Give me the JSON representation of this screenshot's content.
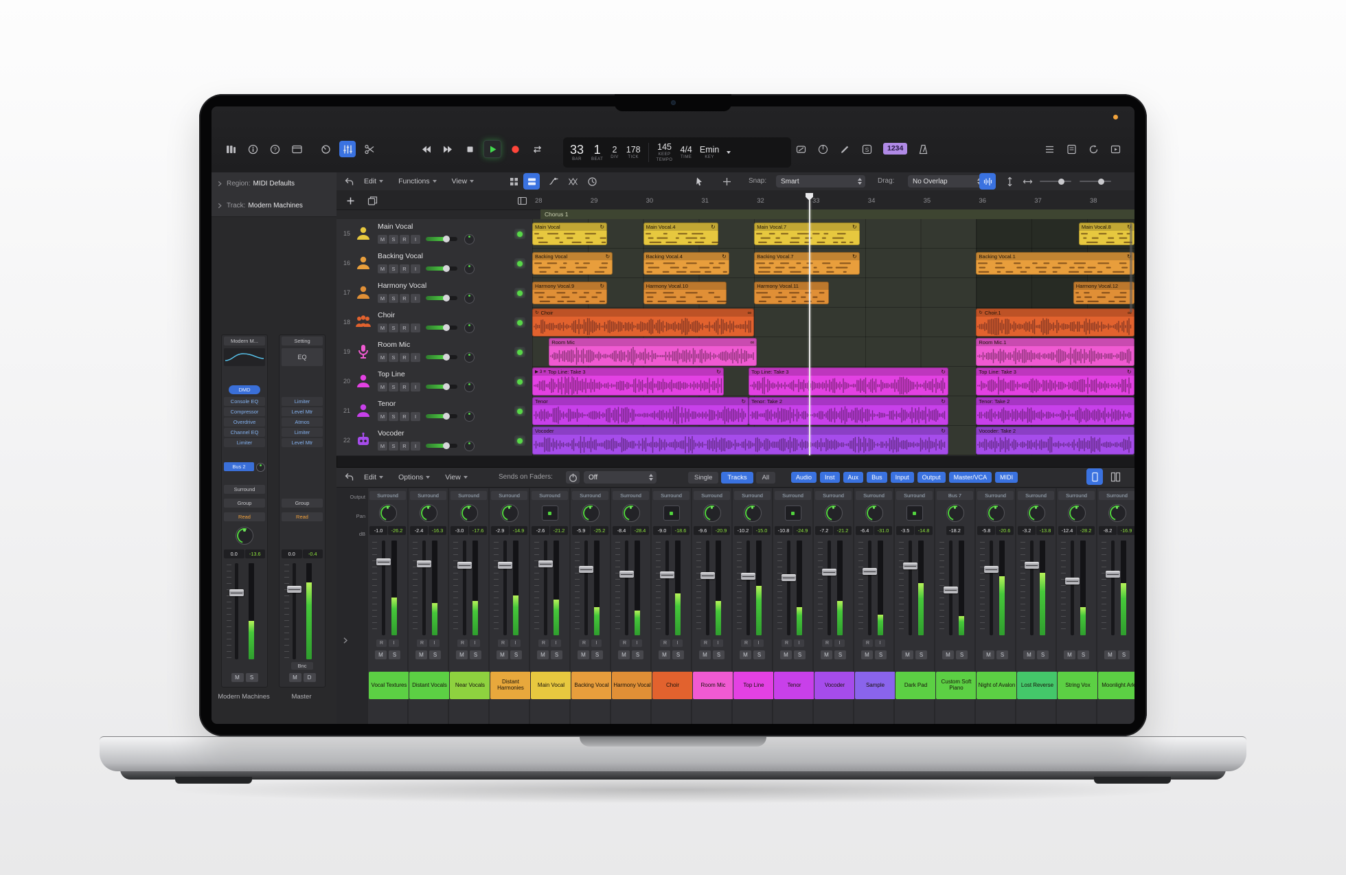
{
  "control_bar": {
    "left_icons": [
      "library-icon",
      "inspector-icon",
      "quick-help-icon",
      "toolbar-icon"
    ],
    "mode_icons": [
      "smart-controls-icon",
      "mixer-icon",
      "editors-icon"
    ],
    "transport_icons": [
      "rewind-icon",
      "forward-icon",
      "stop-icon",
      "play-icon",
      "record-icon",
      "cycle-icon"
    ],
    "lcd": {
      "bar": "33",
      "bar_label": "BAR",
      "beat": "1",
      "beat_label": "BEAT",
      "div": "2",
      "div_label": "DIV",
      "tick": "178",
      "tick_label": "TICK",
      "tempo": "145",
      "tempo_mode": "KEEP",
      "tempo_label": "TEMPO",
      "time_sig": "4/4",
      "time_label": "TIME",
      "key": "Emin",
      "key_label": "KEY"
    },
    "status_icons": [
      "punch-icon",
      "tuner-icon",
      "pencil-icon",
      "solo-icon"
    ],
    "count_in_badge": "1234",
    "metronome_icon": "metronome-icon",
    "right_icons": [
      "list-editors-icon",
      "note-pads-icon",
      "loop-browser-icon",
      "browsers-icon"
    ]
  },
  "inspector": {
    "region": {
      "label": "Region:",
      "value": "MIDI Defaults"
    },
    "track": {
      "label": "Track:",
      "value": "Modern Machines"
    },
    "strips": [
      {
        "setting": "Modern M...",
        "dmd": "DMD",
        "plugins": [
          "Console EQ",
          "Compressor",
          "Overdrive",
          "Channel EQ",
          "Limiter"
        ],
        "send": "Bus 2",
        "output": "Surround",
        "group": "Group",
        "automation": "Read",
        "volume": "0.0",
        "level": "-13.6",
        "buttons": [
          "M",
          "S"
        ],
        "name": "Modern Machines"
      },
      {
        "setting": "Setting",
        "eq_label": "EQ",
        "plugins": [
          "Limiter",
          "Level Mtr",
          "Atmos",
          "Limiter",
          "Level Mtr"
        ],
        "group": "Group",
        "automation": "Read",
        "volume": "0.0",
        "level": "-0.4",
        "bounce": "Bnc",
        "buttons": [
          "M",
          "D"
        ],
        "name": "Master"
      }
    ]
  },
  "tracks_area": {
    "menus": [
      "Edit",
      "Functions",
      "View"
    ],
    "left_icons": [
      "back-icon",
      "grid-cells-icon",
      "grid-rows-icon",
      "automation-icon",
      "crossfade-icon",
      "flex-icon"
    ],
    "tool_icons": [
      "pointer-tool-icon",
      "marquee-tool-icon"
    ],
    "right_icons": [
      "catch-icon",
      "vzoom-icon",
      "hzoom-icon"
    ],
    "ruler_icons": [
      "plus-icon",
      "dup-track-icon",
      "header-config-icon"
    ],
    "snap": {
      "label": "Snap:",
      "value": "Smart"
    },
    "drag": {
      "label": "Drag:",
      "value": "No Overlap"
    },
    "ruler_bars": [
      "28",
      "29",
      "30",
      "31",
      "32",
      "33",
      "34",
      "35",
      "36",
      "37",
      "38"
    ],
    "section_marker": "Chorus 1",
    "playhead_bar": 33,
    "tracks": [
      {
        "num": "15",
        "name": "Main Vocal",
        "icon": "vocalist-icon",
        "color": "#e7c83f",
        "buttons": [
          "M",
          "S",
          "R",
          "I"
        ]
      },
      {
        "num": "16",
        "name": "Backing Vocal",
        "icon": "vocalist-icon",
        "color": "#e89e3c",
        "buttons": [
          "M",
          "S",
          "R",
          "I"
        ]
      },
      {
        "num": "17",
        "name": "Harmony Vocal",
        "icon": "vocalist-icon",
        "color": "#e08f36",
        "buttons": [
          "M",
          "S",
          "R",
          "I"
        ]
      },
      {
        "num": "18",
        "name": "Choir",
        "icon": "choir-icon",
        "color": "#e2622e",
        "buttons": [
          "M",
          "S",
          "R",
          "I"
        ]
      },
      {
        "num": "19",
        "name": "Room Mic",
        "icon": "mic-icon",
        "color": "#f05ad2",
        "buttons": [
          "M",
          "S",
          "R",
          "I"
        ]
      },
      {
        "num": "20",
        "name": "Top Line",
        "icon": "vocalist-icon",
        "color": "#e341e3",
        "buttons": [
          "M",
          "S",
          "R",
          "I"
        ]
      },
      {
        "num": "21",
        "name": "Tenor",
        "icon": "vocalist-icon",
        "color": "#c840ea",
        "buttons": [
          "M",
          "S",
          "R",
          "I"
        ]
      },
      {
        "num": "22",
        "name": "Vocoder",
        "icon": "robot-icon",
        "color": "#a64ceb",
        "buttons": [
          "M",
          "S",
          "R",
          "I"
        ]
      }
    ],
    "regions": [
      {
        "track": 0,
        "label": "Main Vocal",
        "start": 28,
        "len": 1.35,
        "type": "notes",
        "badge": "loop"
      },
      {
        "track": 0,
        "label": "Main Vocal.4",
        "start": 30,
        "len": 1.35,
        "type": "notes",
        "badge": "loop"
      },
      {
        "track": 0,
        "label": "Main Vocal.7",
        "start": 32,
        "len": 1.9,
        "type": "notes",
        "badge": "loop"
      },
      {
        "track": 0,
        "label": "Main Vocal.8",
        "start": 37.85,
        "len": 1.0,
        "type": "notes",
        "badge": "loop"
      },
      {
        "track": 1,
        "label": "Backing Vocal",
        "start": 28,
        "len": 1.45,
        "type": "notes",
        "badge": "loop"
      },
      {
        "track": 1,
        "label": "Backing Vocal.4",
        "start": 30,
        "len": 1.55,
        "type": "notes",
        "badge": "loop"
      },
      {
        "track": 1,
        "label": "Backing Vocal.7",
        "start": 32,
        "len": 1.9,
        "type": "notes",
        "badge": "loop"
      },
      {
        "track": 1,
        "label": "Backing Vocal.1",
        "start": 36,
        "len": 2.85,
        "type": "notes",
        "badge": "loop"
      },
      {
        "track": 2,
        "label": "Harmony Vocal.9",
        "start": 28,
        "len": 1.35,
        "type": "notes",
        "badge": "loop"
      },
      {
        "track": 2,
        "label": "Harmony Vocal.10",
        "start": 30,
        "len": 1.5,
        "type": "notes"
      },
      {
        "track": 2,
        "label": "Harmony Vocal.11",
        "start": 32,
        "len": 1.35,
        "type": "notes"
      },
      {
        "track": 2,
        "label": "Harmony Vocal.12",
        "start": 37.75,
        "len": 1.1,
        "type": "notes"
      },
      {
        "track": 3,
        "label": "Choir",
        "start": 28,
        "len": 4.0,
        "type": "wave",
        "badge": "infinity",
        "prefix": "↻"
      },
      {
        "track": 3,
        "label": "Choir.1",
        "start": 36,
        "len": 2.85,
        "type": "wave",
        "badge": "infinity",
        "prefix": "↻"
      },
      {
        "track": 4,
        "label": "Room Mic",
        "start": 28.3,
        "len": 3.75,
        "type": "wave",
        "badge": "infinity"
      },
      {
        "track": 4,
        "label": "Room Mic.1",
        "start": 36,
        "len": 2.85,
        "type": "wave"
      },
      {
        "track": 5,
        "label": "Top Line: Take 3",
        "start": 28,
        "len": 3.45,
        "type": "wave",
        "badge": "loop",
        "prefix": "▶ 3 ≡"
      },
      {
        "track": 5,
        "label": "Top Line: Take 3",
        "start": 31.9,
        "len": 3.6,
        "type": "wave",
        "badge": "loop"
      },
      {
        "track": 5,
        "label": "Top Line: Take 3",
        "start": 36,
        "len": 2.85,
        "type": "wave",
        "badge": "loop"
      },
      {
        "track": 6,
        "label": "Tenor",
        "start": 28,
        "len": 3.9,
        "type": "wave",
        "badge": "loop"
      },
      {
        "track": 6,
        "label": "Tenor: Take 2",
        "start": 31.9,
        "len": 3.6,
        "type": "wave",
        "badge": "loop"
      },
      {
        "track": 6,
        "label": "Tenor: Take 2",
        "start": 36,
        "len": 2.85,
        "type": "wave"
      },
      {
        "track": 7,
        "label": "Vocoder",
        "start": 28,
        "len": 7.5,
        "type": "wave",
        "badge": "loop"
      },
      {
        "track": 7,
        "label": "Vocoder: Take 2",
        "start": 36,
        "len": 2.85,
        "type": "wave"
      }
    ]
  },
  "mixer": {
    "menus": [
      "Edit",
      "Options",
      "View"
    ],
    "sends": {
      "label": "Sends on Faders:",
      "value": "Off"
    },
    "view_modes": [
      "Single",
      "Tracks",
      "All"
    ],
    "active_view_mode": "Tracks",
    "filters": [
      "Audio",
      "Inst",
      "Aux",
      "Bus",
      "Input",
      "Output",
      "Master/VCA",
      "MIDI"
    ],
    "right_icons": [
      "single-strip-icon",
      "dual-strips-icon"
    ],
    "row_labels": {
      "output": "Output",
      "pan": "Pan",
      "db": "dB"
    },
    "channel_buttons": {
      "mute": "M",
      "solo": "S",
      "record": "R",
      "input": "I"
    },
    "channels": [
      {
        "output": "Surround",
        "name": "Vocal Textures",
        "color": "#5cd044",
        "volume": "-1.0",
        "level": "-26.2",
        "pan": "knob",
        "rec": true,
        "meter": 0.4,
        "fader": 0.8
      },
      {
        "output": "Surround",
        "name": "Distant Vocals",
        "color": "#5cd044",
        "volume": "-2.4",
        "level": "-16.3",
        "pan": "knob",
        "rec": true,
        "meter": 0.34,
        "fader": 0.77
      },
      {
        "output": "Surround",
        "name": "Near Vocals",
        "color": "#8ed23f",
        "volume": "-3.0",
        "level": "-17.6",
        "pan": "knob",
        "rec": true,
        "meter": 0.36,
        "fader": 0.76
      },
      {
        "output": "Surround",
        "name": "Distant Harmonies",
        "color": "#e8a83c",
        "volume": "-2.9",
        "level": "-14.9",
        "pan": "knob",
        "rec": true,
        "meter": 0.42,
        "fader": 0.76
      },
      {
        "output": "Surround",
        "name": "Main Vocal",
        "color": "#e7c83f",
        "volume": "-2.6",
        "level": "-21.2",
        "pan": "square",
        "rec": true,
        "meter": 0.38,
        "fader": 0.77
      },
      {
        "output": "Surround",
        "name": "Backing Vocal",
        "color": "#e89e3c",
        "volume": "-5.9",
        "level": "-25.2",
        "pan": "knob",
        "rec": true,
        "meter": 0.3,
        "fader": 0.71
      },
      {
        "output": "Surround",
        "name": "Harmony Vocal",
        "color": "#e08f36",
        "volume": "-8.4",
        "level": "-28.4",
        "pan": "knob",
        "rec": true,
        "meter": 0.26,
        "fader": 0.66
      },
      {
        "output": "Surround",
        "name": "Choir",
        "color": "#e2622e",
        "volume": "-9.0",
        "level": "-18.6",
        "pan": "square",
        "rec": true,
        "meter": 0.44,
        "fader": 0.65
      },
      {
        "output": "Surround",
        "name": "Room Mic",
        "color": "#f05ad2",
        "volume": "-9.6",
        "level": "-20.9",
        "pan": "knob",
        "rec": true,
        "meter": 0.36,
        "fader": 0.64
      },
      {
        "output": "Surround",
        "name": "Top Line",
        "color": "#e341e3",
        "volume": "-10.2",
        "level": "-15.0",
        "pan": "knob",
        "rec": true,
        "meter": 0.52,
        "fader": 0.63
      },
      {
        "output": "Surround",
        "name": "Tenor",
        "color": "#c840ea",
        "volume": "-10.8",
        "level": "-24.9",
        "pan": "square",
        "rec": true,
        "meter": 0.3,
        "fader": 0.62
      },
      {
        "output": "Surround",
        "name": "Vocoder",
        "color": "#a64ceb",
        "volume": "-7.2",
        "level": "-21.2",
        "pan": "knob",
        "rec": true,
        "meter": 0.36,
        "fader": 0.68
      },
      {
        "output": "Surround",
        "name": "Sample",
        "color": "#8a64ec",
        "volume": "-6.4",
        "level": "-31.0",
        "pan": "knob",
        "rec": true,
        "meter": 0.22,
        "fader": 0.69
      },
      {
        "output": "Surround",
        "name": "Dark Pad",
        "color": "#5cd044",
        "volume": "-3.5",
        "level": "-14.8",
        "pan": "square",
        "rec": false,
        "meter": 0.55,
        "fader": 0.75
      },
      {
        "output": "Bus 7",
        "name": "Custom Soft Piano",
        "color": "#5cd044",
        "volume": "-18.2",
        "level": "",
        "pan": "knob",
        "rec": false,
        "meter": 0.2,
        "fader": 0.48
      },
      {
        "output": "Surround",
        "name": "Night of Avalon",
        "color": "#5cd044",
        "volume": "-5.8",
        "level": "-20.6",
        "pan": "knob",
        "rec": false,
        "meter": 0.62,
        "fader": 0.71
      },
      {
        "output": "Surround",
        "name": "Lost Reverse",
        "color": "#44c76a",
        "volume": "-3.2",
        "level": "-13.8",
        "pan": "knob",
        "rec": false,
        "meter": 0.66,
        "fader": 0.76
      },
      {
        "output": "Surround",
        "name": "String Vox",
        "color": "#5cd044",
        "volume": "-12.4",
        "level": "-28.2",
        "pan": "knob",
        "rec": false,
        "meter": 0.3,
        "fader": 0.58
      },
      {
        "output": "Surround",
        "name": "Moonlight Ark",
        "color": "#5cd044",
        "volume": "-8.2",
        "level": "-16.9",
        "pan": "knob",
        "rec": false,
        "meter": 0.55,
        "fader": 0.66
      }
    ]
  }
}
